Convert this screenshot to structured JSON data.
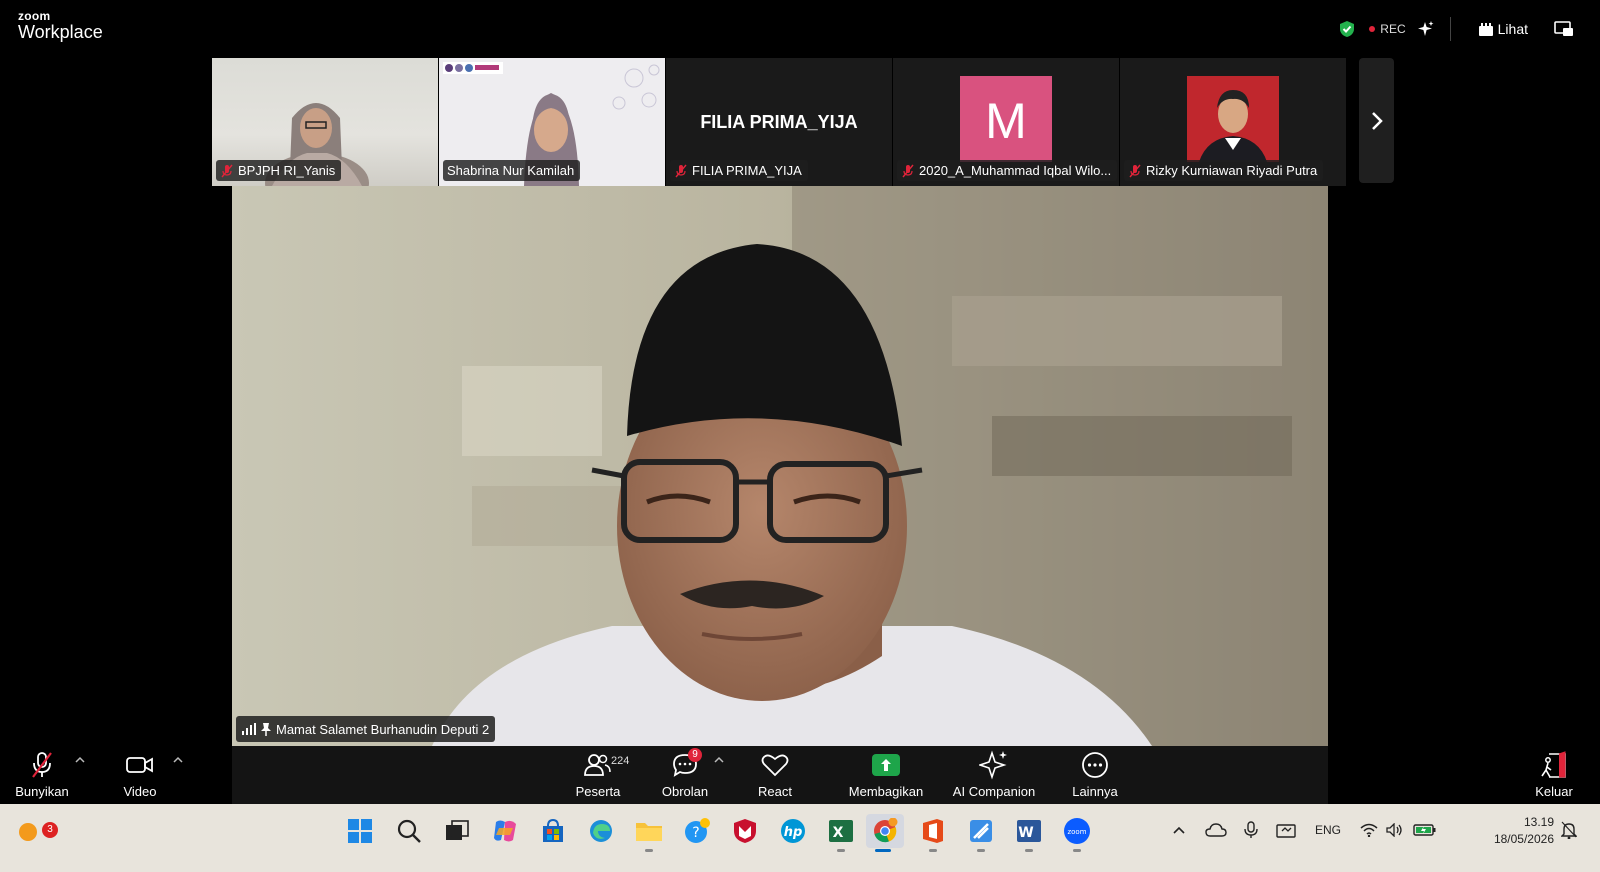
{
  "app": {
    "logo_small": "zoom",
    "logo_title": "Workplace"
  },
  "topbar": {
    "rec_label": "REC",
    "view_label": "Lihat"
  },
  "gallery": [
    {
      "name": "BPJPH RI_Yanis",
      "muted": true
    },
    {
      "name": "Shabrina Nur Kamilah",
      "muted": false
    },
    {
      "name": "FILIA PRIMA_YIJA",
      "muted": true,
      "display_name": "FILIA PRIMA_YIJA"
    },
    {
      "name": "2020_A_Muhammad Iqbal Wilo...",
      "muted": true,
      "avatar_letter": "M"
    },
    {
      "name": "Rizky Kurniawan Riyadi Putra",
      "muted": true
    }
  ],
  "speaker": {
    "name": "Mamat Salamet Burhanudin Deputi 2"
  },
  "toolbar": {
    "audio_label": "Bunyikan",
    "video_label": "Video",
    "participants_label": "Peserta",
    "participants_count": "224",
    "chat_label": "Obrolan",
    "chat_badge": "9",
    "react_label": "React",
    "share_label": "Membagikan",
    "ai_label": "AI Companion",
    "more_label": "Lainnya",
    "leave_label": "Keluar"
  },
  "taskbar": {
    "weather_badge": "3",
    "language": "ENG",
    "time": "13.19",
    "date": "18/05/2026"
  },
  "colors": {
    "rec_dot": "#e0243a",
    "share_green": "#1ea54a",
    "avatar_m": "#d9527f",
    "avatar_r_bg": "#c0272d"
  }
}
